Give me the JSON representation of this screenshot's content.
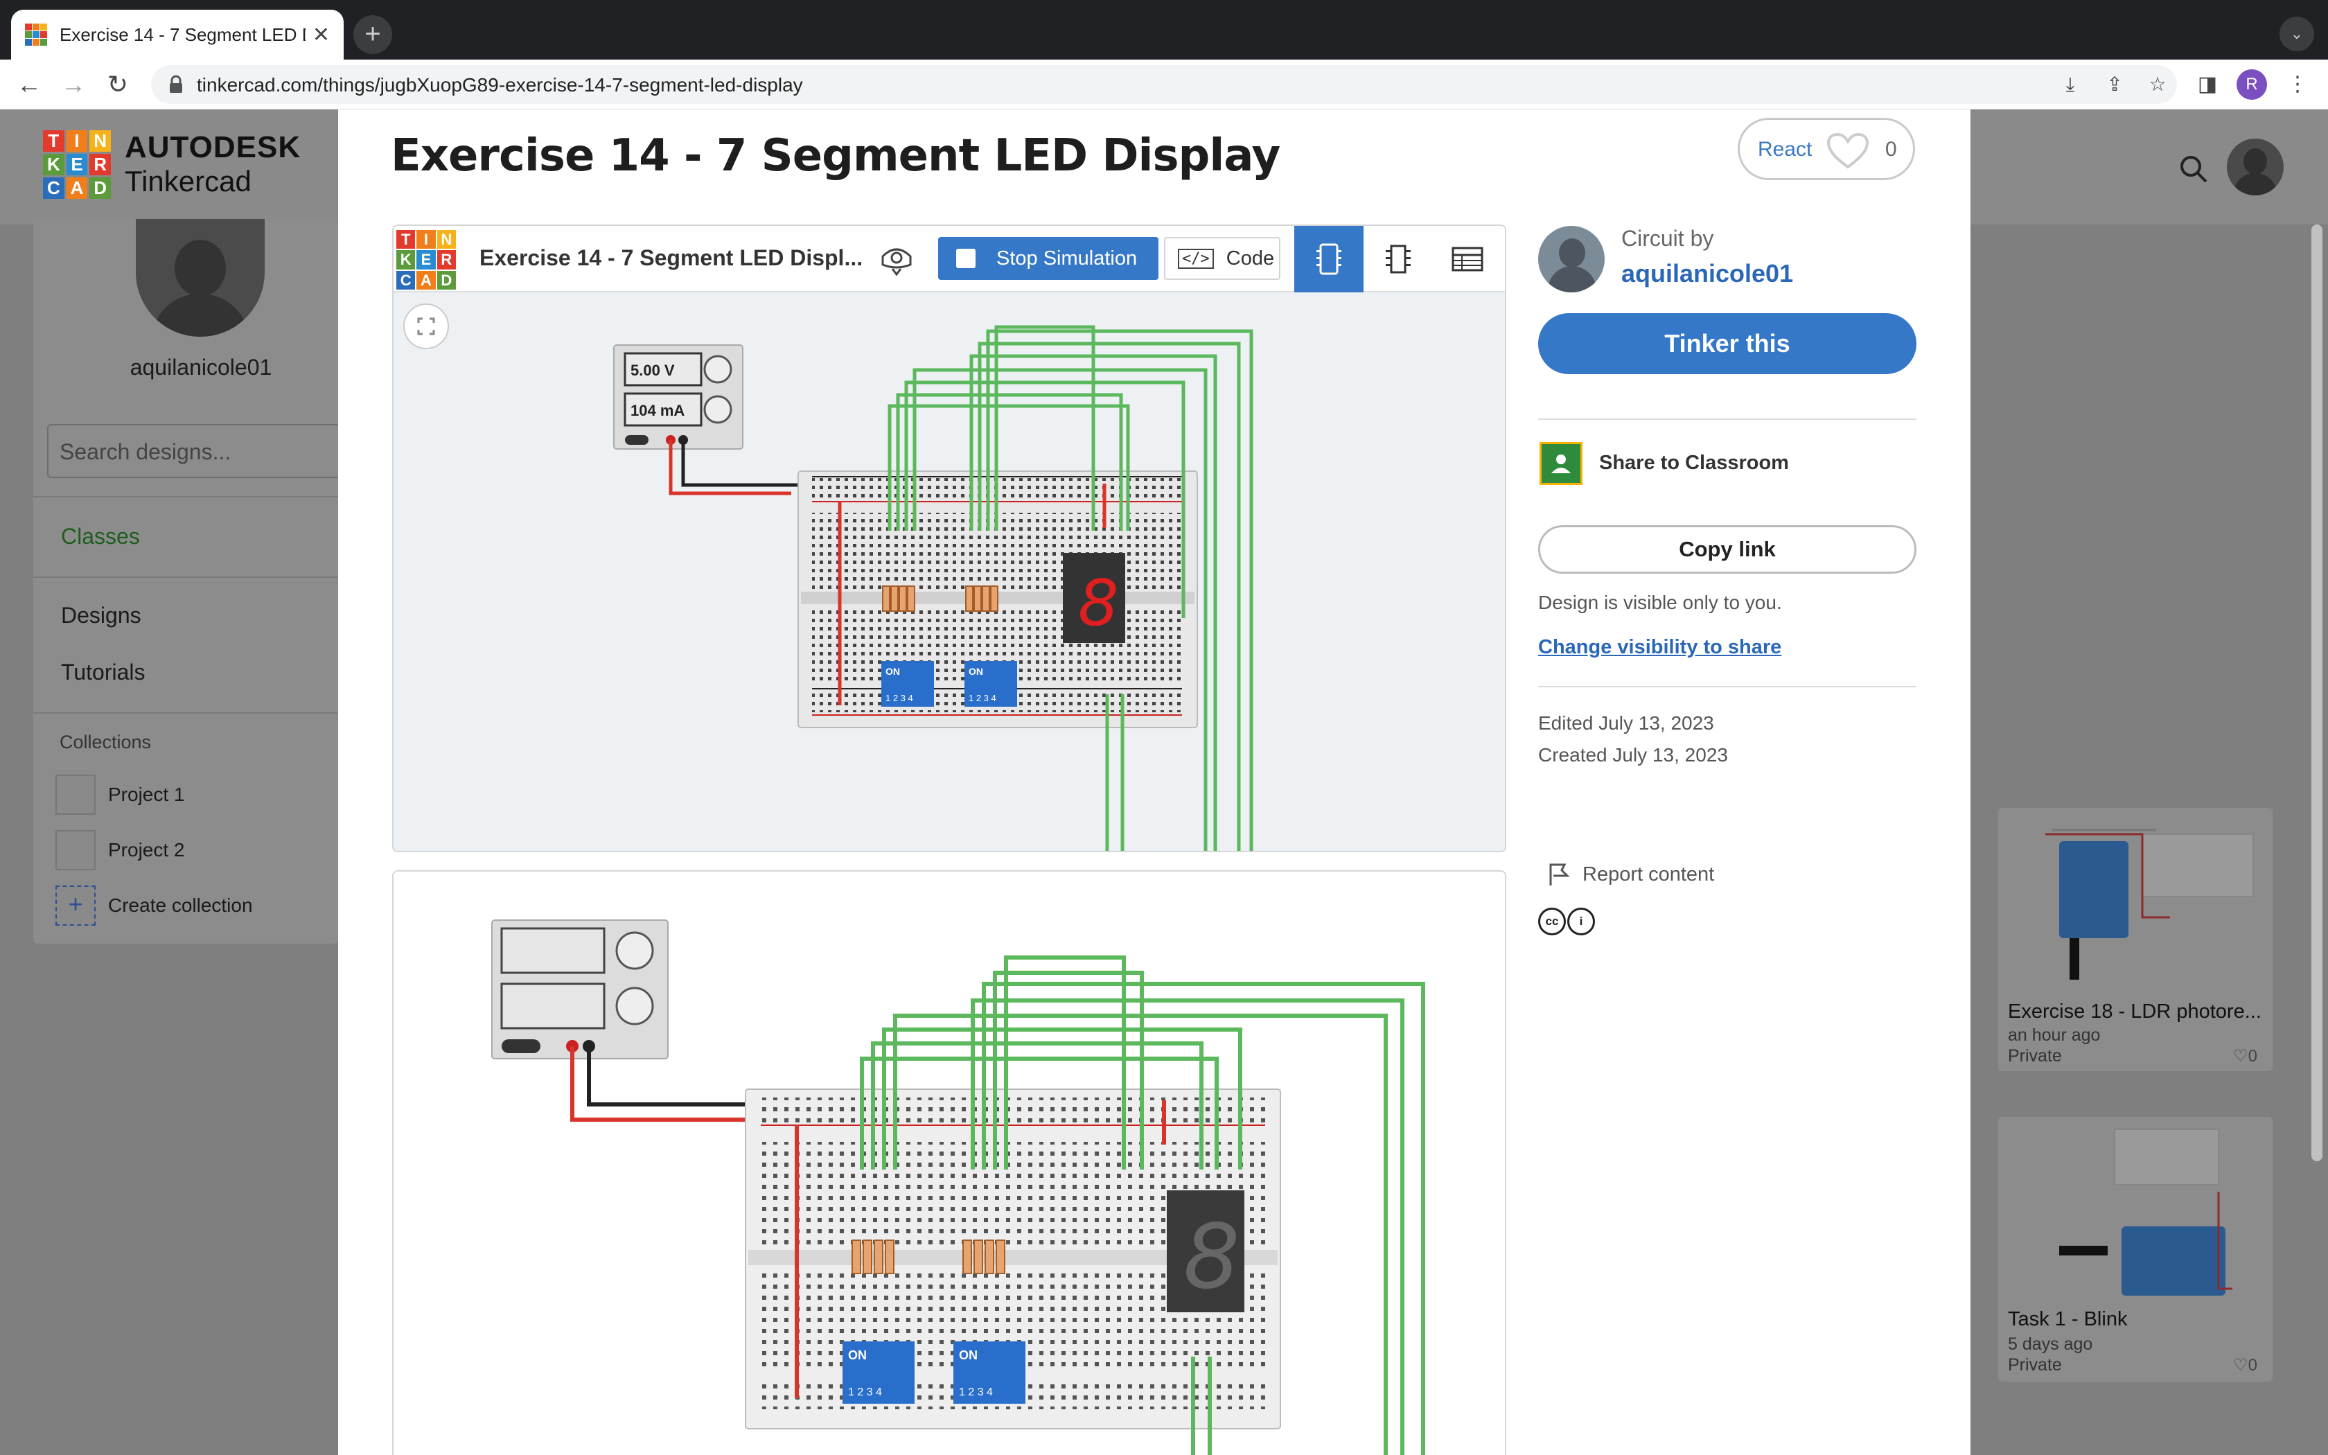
{
  "browser": {
    "tab_title": "Exercise 14 - 7 Segment LED D",
    "url": "tinkercad.com/things/jugbXuopG89-exercise-14-7-segment-led-display",
    "profile_initial": "R",
    "new_tab_label": "+"
  },
  "site": {
    "logo_letters": [
      "T",
      "I",
      "N",
      "K",
      "E",
      "R",
      "C",
      "A",
      "D"
    ],
    "brand_line1": "AUTODESK",
    "brand_line2": "Tinkercad"
  },
  "sidebar": {
    "username": "aquilanicole01",
    "search_placeholder": "Search designs...",
    "items": [
      {
        "label": "Classes"
      },
      {
        "label": "Designs"
      },
      {
        "label": "Tutorials"
      }
    ],
    "collections_title": "Collections",
    "projects": [
      {
        "label": "Project 1"
      },
      {
        "label": "Project 2"
      }
    ],
    "create_collection": "Create collection",
    "create_icon": "+"
  },
  "modal": {
    "title": "Exercise 14 - 7 Segment LED Display",
    "react_label": "React",
    "react_count": "0",
    "embed": {
      "title": "Exercise 14 - 7 Segment LED Displ...",
      "stop_label": "Stop Simulation",
      "code_label": "Code",
      "code_icon": "</>",
      "power_voltage": "5.00 V",
      "power_current": "104 mA",
      "seven_seg_digit": "8",
      "dip_on": "ON",
      "dip_nums": "1 2 3 4"
    },
    "right": {
      "circuit_by": "Circuit by",
      "author": "aquilanicole01",
      "tinker_label": "Tinker this",
      "share_classroom": "Share to Classroom",
      "copy_link": "Copy link",
      "visibility_text": "Design is visible only to you.",
      "change_visibility": "Change visibility to share",
      "edited": "Edited July 13, 2023",
      "created": "Created July 13, 2023",
      "license_cc": "cc",
      "license_by": "i",
      "report": "Report content"
    }
  },
  "cards": [
    {
      "title": "Exercise 18 - LDR photore...",
      "time": "an hour ago",
      "privacy": "Private",
      "likes": "0"
    },
    {
      "title": "Task 1 - Blink",
      "time": "5 days ago",
      "privacy": "Private",
      "likes": "0"
    }
  ],
  "colors": {
    "tinkercad_blue": "#3578c8",
    "link_blue": "#2b67b8",
    "wire_green": "#5cb85c",
    "wire_red": "#d9342b",
    "logo_tile_colors": [
      "#e23b2e",
      "#f07f1b",
      "#f6b21b",
      "#5b9b3b",
      "#2a8cd0",
      "#e23b2e",
      "#2a6ebb",
      "#f07f1b",
      "#5b9b3b"
    ]
  },
  "icons": {
    "back": "back-arrow-icon",
    "forward": "forward-arrow-icon",
    "reload": "reload-icon",
    "lock": "lock-icon",
    "install": "install-icon",
    "share": "share-icon",
    "star": "star-icon",
    "sidepanel": "side-panel-icon",
    "menu": "kebab-menu-icon",
    "search": "search-icon"
  }
}
